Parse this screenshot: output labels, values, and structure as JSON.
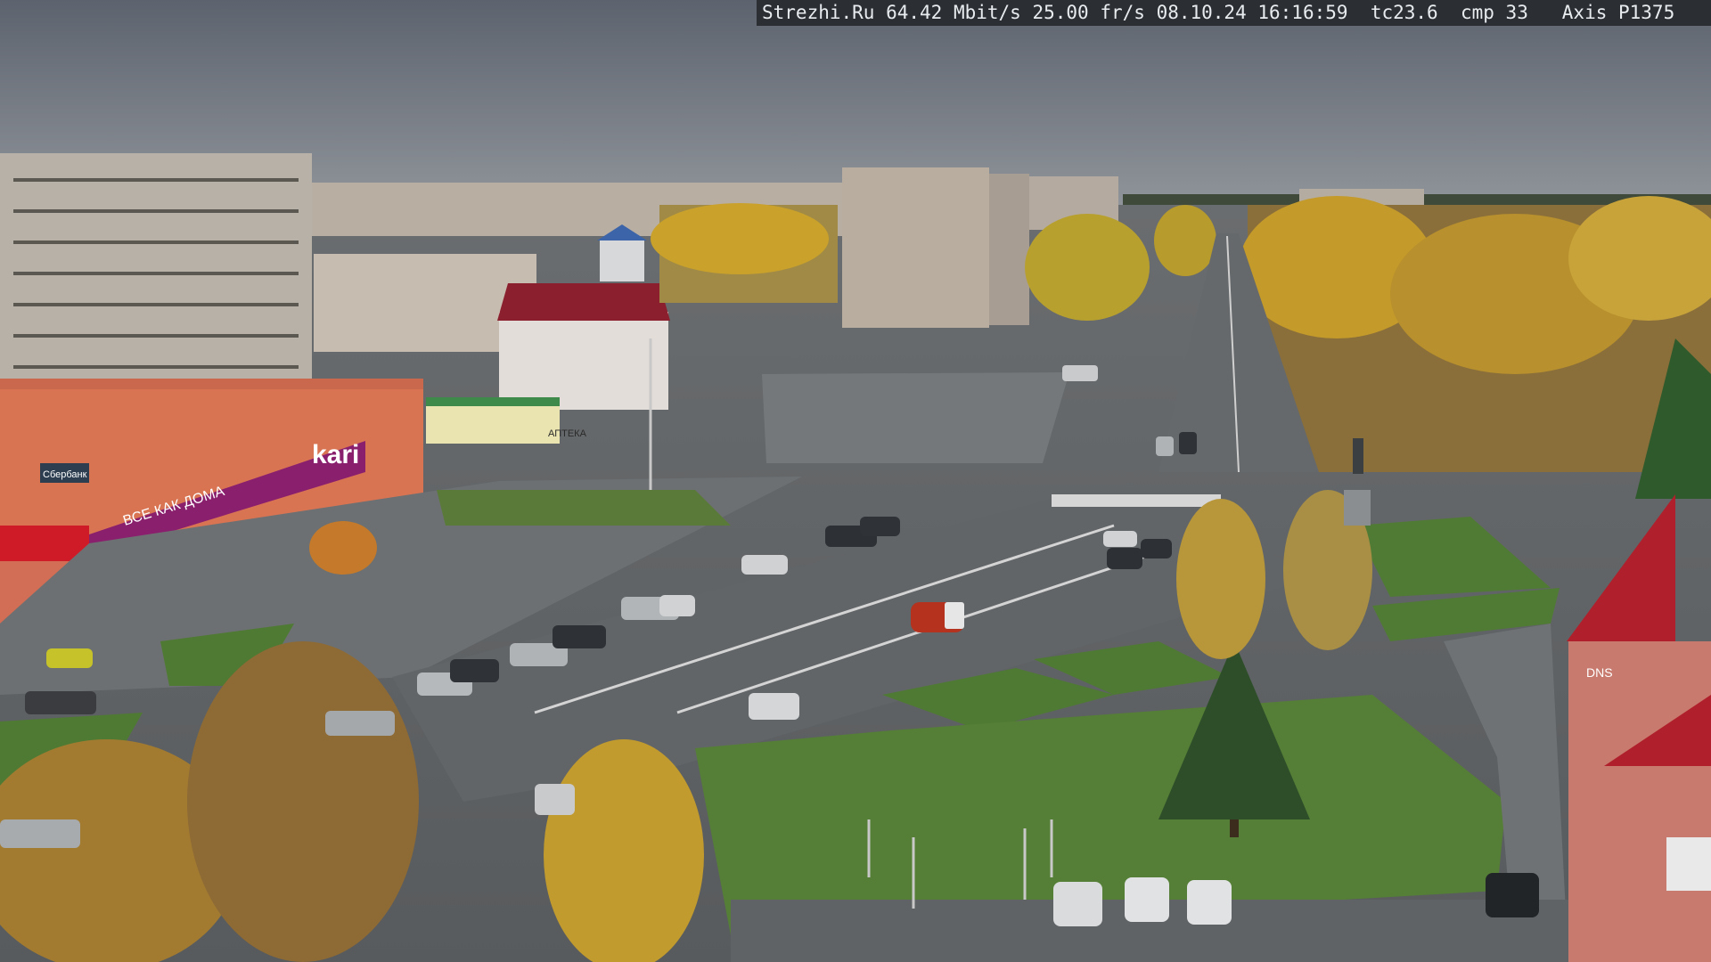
{
  "camera_overlay": {
    "site": "Strezhi.Ru",
    "bitrate": "64.42 Mbit/s",
    "framerate": "25.00 fr/s",
    "date": "08.10.24",
    "time": "16:16:59",
    "tc": "tc23.6",
    "cmp": "cmp 33",
    "camera_model": "Axis P1375"
  },
  "signage": {
    "store_name": "kari",
    "store_sign_text": "ВСЕ КАК ДОМА",
    "bank_sign": "Сбербанк",
    "pharmacy_sign": "АПТЕКА",
    "tower_sign": "DNS"
  },
  "colors": {
    "sky": "#6b7280",
    "asphalt": "#5f6366",
    "grass": "#4f7a33",
    "autumn_foliage": "#c9a12b",
    "kari_magenta": "#8a1f6e",
    "roof_red": "#b0202c"
  }
}
